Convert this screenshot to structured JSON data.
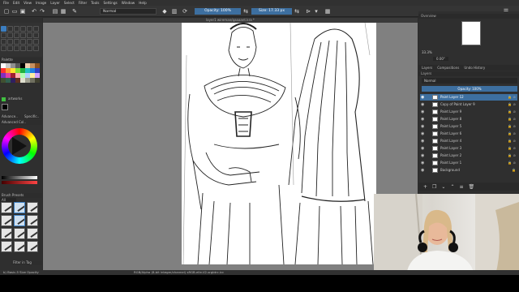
{
  "menu": [
    "File",
    "Edit",
    "View",
    "Image",
    "Layer",
    "Select",
    "Filter",
    "Tools",
    "Settings",
    "Window",
    "Help"
  ],
  "toolbar": {
    "blend_mode": "Normal",
    "opacity_label": "Opacity: 100%",
    "size_label": "Size: 17.33 px"
  },
  "document_tab": "layer1 wireman/qaaaant.kra *",
  "left_docker": {
    "palette_title": "Palette",
    "advanced_color_title": "Advanced Col..",
    "advanced_label": "Advance..",
    "specific_label": "Specific..",
    "brush_presets_title": "Brush Presets",
    "filter_label": "Filter in Tag",
    "tag_label": "All",
    "artwork_label": "artworks"
  },
  "right_docker": {
    "overview_title": "Overview",
    "zoom_value": "33.3%",
    "rotation_value": "0.00°",
    "tabs": [
      "Layers",
      "Compositions",
      "Undo History"
    ],
    "layers_header": "Layers",
    "blend_mode": "Normal",
    "layer_opacity": "Opacity: 100%",
    "layers": [
      {
        "name": "Paint Layer 12",
        "selected": true
      },
      {
        "name": "Copy of Paint Layer 9",
        "selected": false
      },
      {
        "name": "Paint Layer 9",
        "selected": false
      },
      {
        "name": "Paint Layer 8",
        "selected": false
      },
      {
        "name": "Paint Layer 5",
        "selected": false
      },
      {
        "name": "Paint Layer 6",
        "selected": false
      },
      {
        "name": "Paint Layer 4",
        "selected": false
      },
      {
        "name": "Paint Layer 3",
        "selected": false
      },
      {
        "name": "Paint Layer 2",
        "selected": false
      },
      {
        "name": "Paint Layer 1",
        "selected": false
      },
      {
        "name": "Background",
        "selected": false
      }
    ]
  },
  "statusbar": {
    "brush_info": "b) Basic-5 Size Opacity",
    "image_info": "RGB/Alpha (8-bit integer/channel)  sRGB-elle-V2-srgbtrc.icc"
  },
  "colors": {
    "accent": "#3d6fa0",
    "background_dark": "#2b2b2b",
    "canvas_gray": "#808080"
  }
}
